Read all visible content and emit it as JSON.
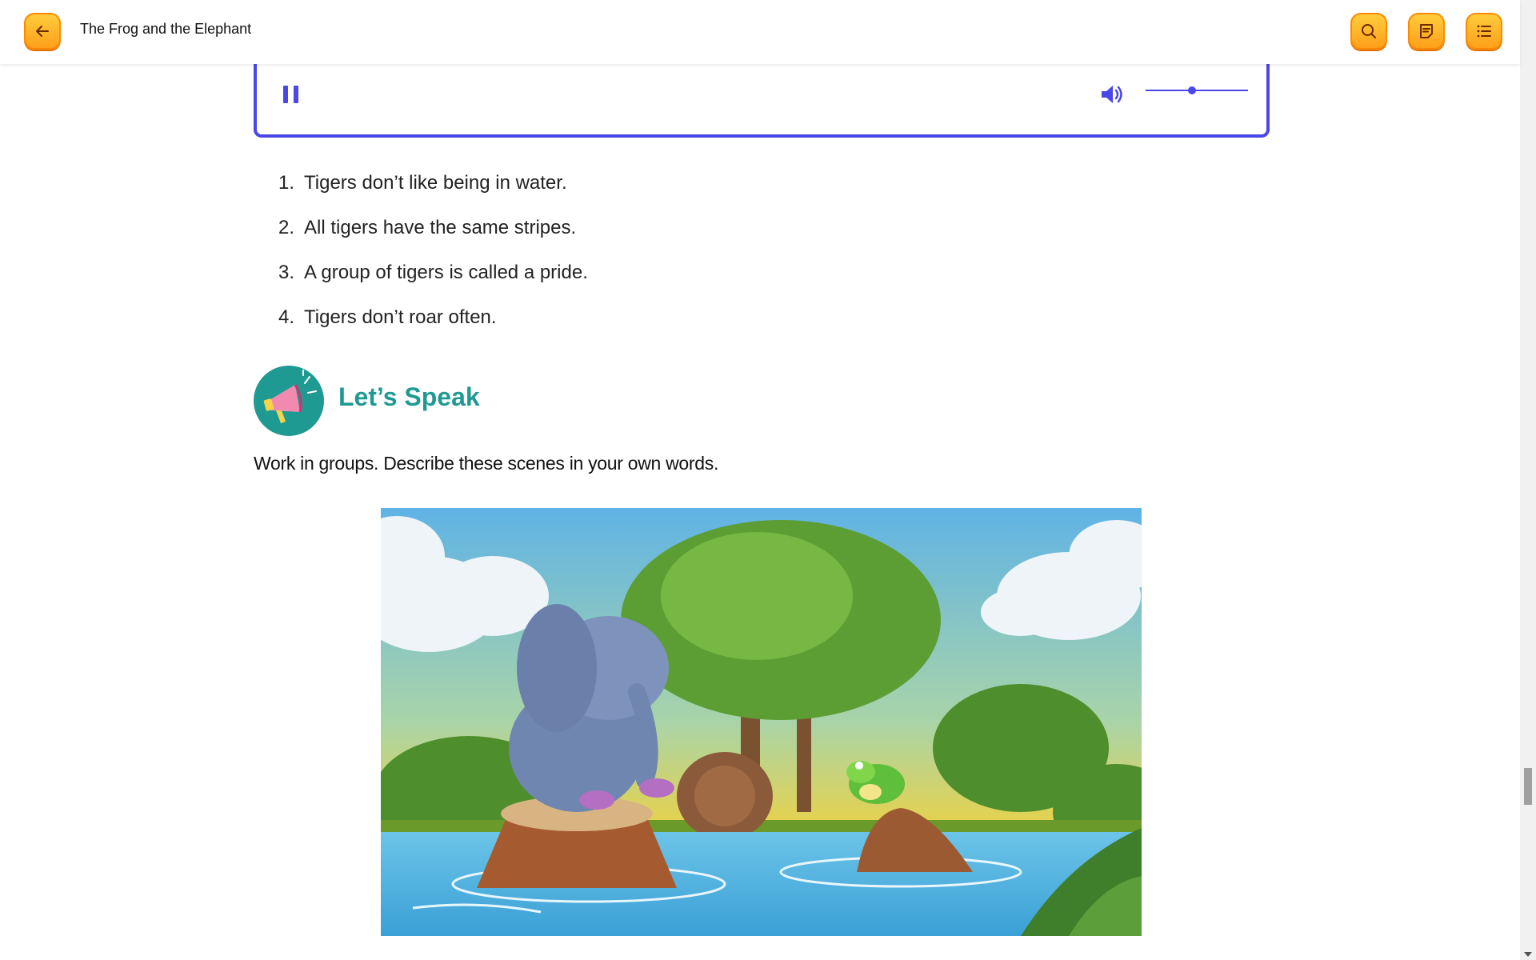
{
  "header": {
    "title": "The Frog and the Elephant",
    "back_icon": "arrow-left-icon",
    "search_icon": "search-icon",
    "notes_icon": "notes-icon",
    "menu_icon": "list-icon"
  },
  "player": {
    "state": "playing",
    "pause_icon": "pause-icon",
    "volume_icon": "volume-icon",
    "volume_level": 0.45
  },
  "questions": [
    {
      "num": "1.",
      "text": "Tigers don’t like being in water."
    },
    {
      "num": "2.",
      "text": "All tigers have the same stripes."
    },
    {
      "num": "3.",
      "text": "A group of tigers is called a pride."
    },
    {
      "num": "4.",
      "text": "Tigers don’t roar often."
    }
  ],
  "speak": {
    "icon": "megaphone-icon",
    "title": "Let’s Speak",
    "instruction": "Work in groups. Describe these scenes in your own words."
  },
  "colors": {
    "accent": "#ff9f1a",
    "player_border": "#4b46e6",
    "speak_title": "#1f9a93"
  }
}
